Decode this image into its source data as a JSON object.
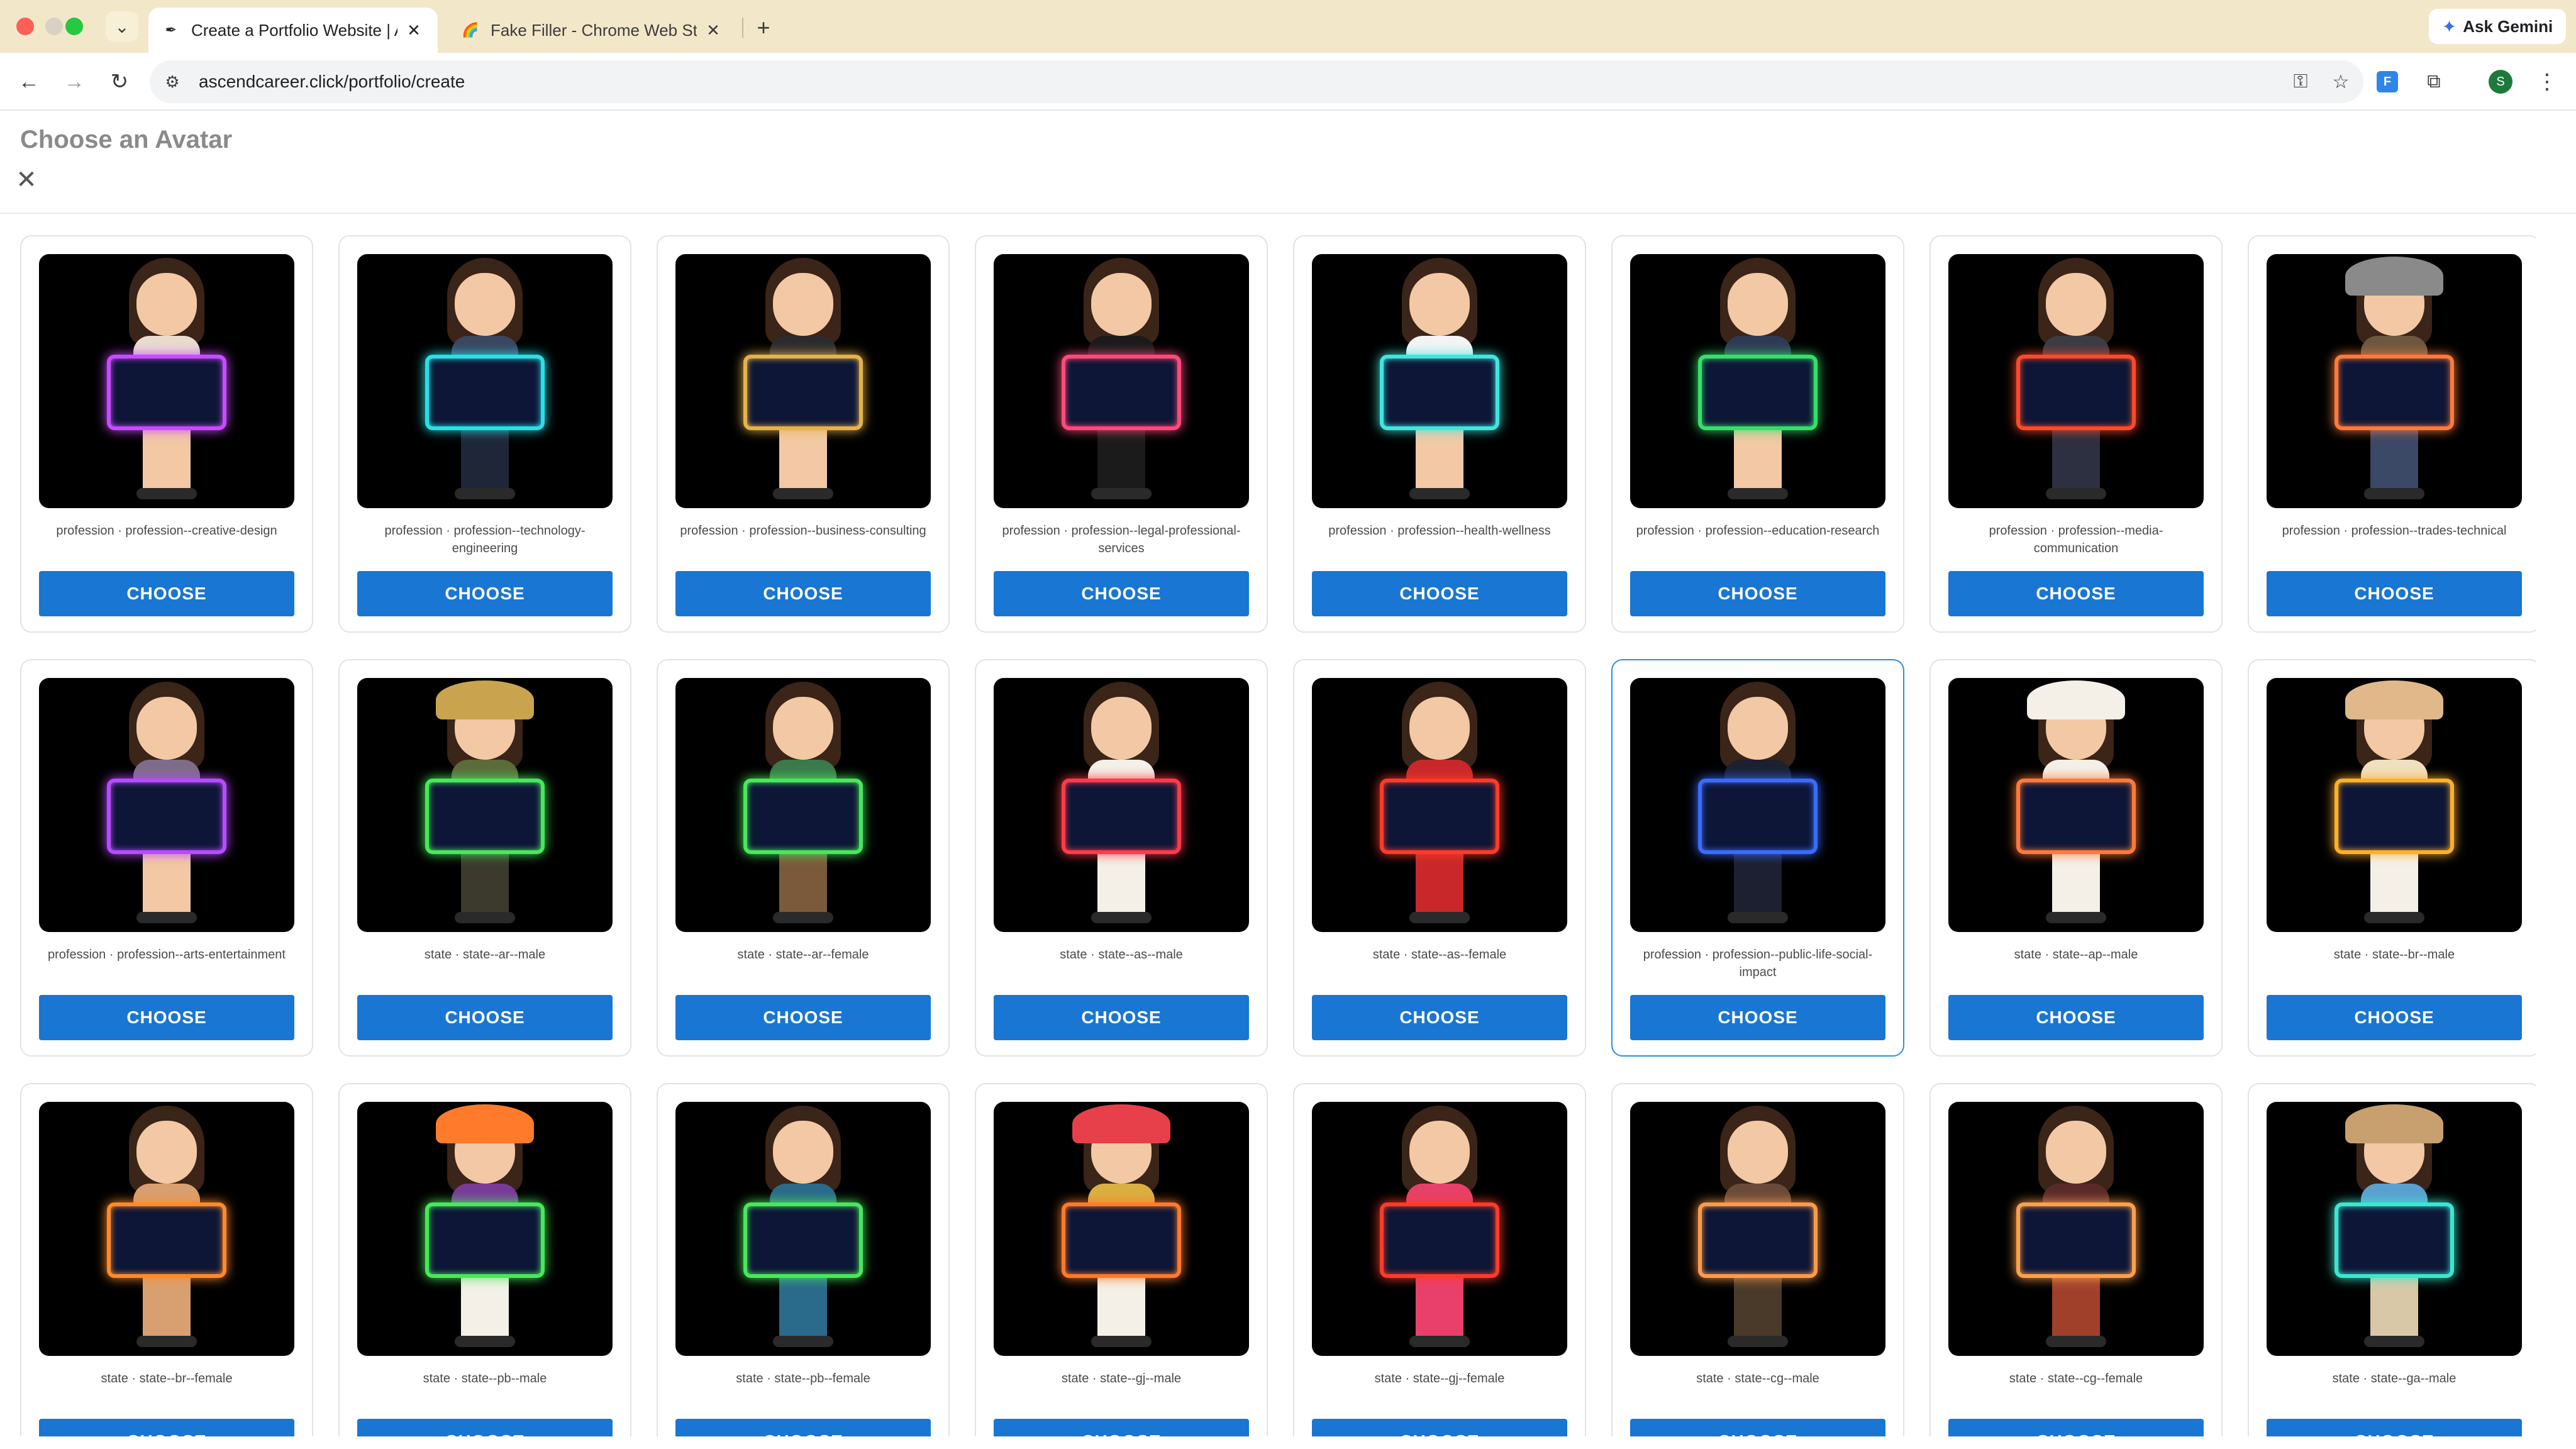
{
  "browser": {
    "tabs": [
      {
        "title": "Create a Portfolio Website | A",
        "active": true,
        "favicon": "feather-icon"
      },
      {
        "title": "Fake Filler - Chrome Web Sto",
        "active": false,
        "favicon": "rainbow-icon"
      }
    ],
    "ask_gemini": "Ask Gemini",
    "url": "ascendcareer.click/portfolio/create",
    "profile_initial": "S"
  },
  "page": {
    "title": "Choose an Avatar",
    "choose_label": "CHOOSE"
  },
  "avatars": [
    {
      "caption": "profession · profession--creative-design",
      "board": "#c94bff",
      "outfit": "#e9dccf",
      "legs": "#f2c9a4",
      "hat": "",
      "selected": false
    },
    {
      "caption": "profession · profession--technology-engineering",
      "board": "#28e0e8",
      "outfit": "#3b4660",
      "legs": "#1f2638",
      "hat": "",
      "selected": false
    },
    {
      "caption": "profession · profession--business-consulting",
      "board": "#e6b24a",
      "outfit": "#2b2b2f",
      "legs": "#f2c9a4",
      "hat": "",
      "selected": false
    },
    {
      "caption": "profession · profession--legal-professional-services",
      "board": "#ff4a7a",
      "outfit": "#1b1b1b",
      "legs": "#1b1b1b",
      "hat": "",
      "selected": false
    },
    {
      "caption": "profession · profession--health-wellness",
      "board": "#3fe6e0",
      "outfit": "#f4f4f4",
      "legs": "#f2c9a4",
      "hat": "",
      "selected": false
    },
    {
      "caption": "profession · profession--education-research",
      "board": "#35e06a",
      "outfit": "#2e3a55",
      "legs": "#f2c9a4",
      "hat": "",
      "selected": false
    },
    {
      "caption": "profession · profession--media-communication",
      "board": "#ff4a2a",
      "outfit": "#3c3c44",
      "legs": "#2d3040",
      "hat": "",
      "selected": false
    },
    {
      "caption": "profession · profession--trades-technical",
      "board": "#ff7a3a",
      "outfit": "#6d5740",
      "legs": "#3b4866",
      "hat": "#8a8a8a",
      "selected": false
    },
    {
      "caption": "profession · profession--arts-entertainment",
      "board": "#b84bff",
      "outfit": "#7d6d88",
      "legs": "#f2c9a4",
      "hat": "",
      "selected": false
    },
    {
      "caption": "state · state--ar--male",
      "board": "#48e85a",
      "outfit": "#5b6b3a",
      "legs": "#3b3a2c",
      "hat": "#c9a34e",
      "selected": false
    },
    {
      "caption": "state · state--ar--female",
      "board": "#48e85a",
      "outfit": "#3a7a4a",
      "legs": "#7a5a3a",
      "hat": "",
      "selected": false
    },
    {
      "caption": "state · state--as--male",
      "board": "#ff3a4a",
      "outfit": "#f4f0e8",
      "legs": "#f4f0e8",
      "hat": "",
      "selected": false
    },
    {
      "caption": "state · state--as--female",
      "board": "#ff3a2a",
      "outfit": "#c9282a",
      "legs": "#c9282a",
      "hat": "",
      "selected": false
    },
    {
      "caption": "profession · profession--public-life-social-impact",
      "board": "#3a6bff",
      "outfit": "#1c2030",
      "legs": "#1c2030",
      "hat": "",
      "selected": true
    },
    {
      "caption": "state · state--ap--male",
      "board": "#ff7a3a",
      "outfit": "#f4f0e8",
      "legs": "#f4f0e8",
      "hat": "#f4f0e8",
      "selected": false
    },
    {
      "caption": "state · state--br--male",
      "board": "#ffb02a",
      "outfit": "#f0e0c0",
      "legs": "#f4f0e8",
      "hat": "#e0b88a",
      "selected": false
    },
    {
      "caption": "state · state--br--female",
      "board": "#ff8a2a",
      "outfit": "#d8a070",
      "legs": "#d8a070",
      "hat": "",
      "selected": false
    },
    {
      "caption": "state · state--pb--male",
      "board": "#48e85a",
      "outfit": "#7a3a9a",
      "legs": "#f4f0e8",
      "hat": "#ff7a2a",
      "selected": false
    },
    {
      "caption": "state · state--pb--female",
      "board": "#48e85a",
      "outfit": "#2a6a8a",
      "legs": "#2a6a8a",
      "hat": "",
      "selected": false
    },
    {
      "caption": "state · state--gj--male",
      "board": "#ff7a2a",
      "outfit": "#d9b040",
      "legs": "#f4f0e8",
      "hat": "#e8404a",
      "selected": false
    },
    {
      "caption": "state · state--gj--female",
      "board": "#ff3a2a",
      "outfit": "#e8406a",
      "legs": "#e8406a",
      "hat": "",
      "selected": false
    },
    {
      "caption": "state · state--cg--male",
      "board": "#ff9a4a",
      "outfit": "#6a4a3a",
      "legs": "#4a3a2a",
      "hat": "",
      "selected": false
    },
    {
      "caption": "state · state--cg--female",
      "board": "#ffa04a",
      "outfit": "#5a2a2a",
      "legs": "#a0402a",
      "hat": "",
      "selected": false
    },
    {
      "caption": "state · state--ga--male",
      "board": "#3ae8d0",
      "outfit": "#5aa0d0",
      "legs": "#d8c8a8",
      "hat": "#c8a070",
      "selected": false
    }
  ],
  "colors": {
    "primary": "#1976d2",
    "selected_border": "#2c8fe0",
    "tabstrip": "#f3e7c9"
  }
}
